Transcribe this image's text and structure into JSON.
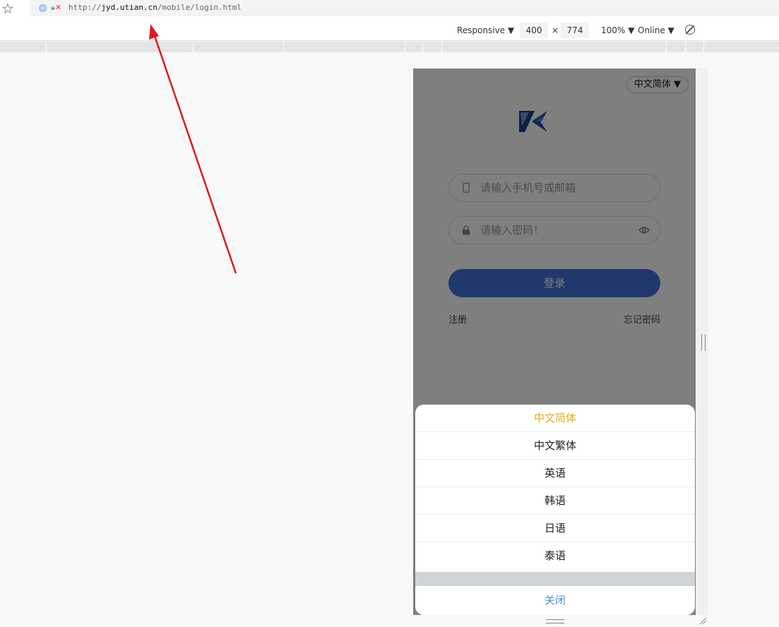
{
  "browser": {
    "url_scheme": "http://",
    "url_host": "jyd.utian.cn",
    "url_path": "/mobile/login.html"
  },
  "devtools": {
    "device_mode": "Responsive",
    "width_value": "400",
    "times": "×",
    "height_value": "774",
    "zoom": "100%",
    "throttle": "Online",
    "caret": "▼"
  },
  "login": {
    "language_toggle": "中文简体 ▼",
    "account_placeholder": "请输入手机号或邮箱",
    "password_placeholder": "请输入密码！",
    "login_button": "登录",
    "register_link": "注册",
    "forgot_link": "忘记密码"
  },
  "language_sheet": {
    "options": [
      "中文简体",
      "中文繁体",
      "英语",
      "韩语",
      "日语",
      "泰语"
    ],
    "selected_index": 0,
    "close_label": "关闭"
  },
  "colors": {
    "primary_button": "#4173db",
    "selected_option": "#e6a817",
    "close_text": "#4f8cd6",
    "annotation_arrow": "#e0191b"
  }
}
